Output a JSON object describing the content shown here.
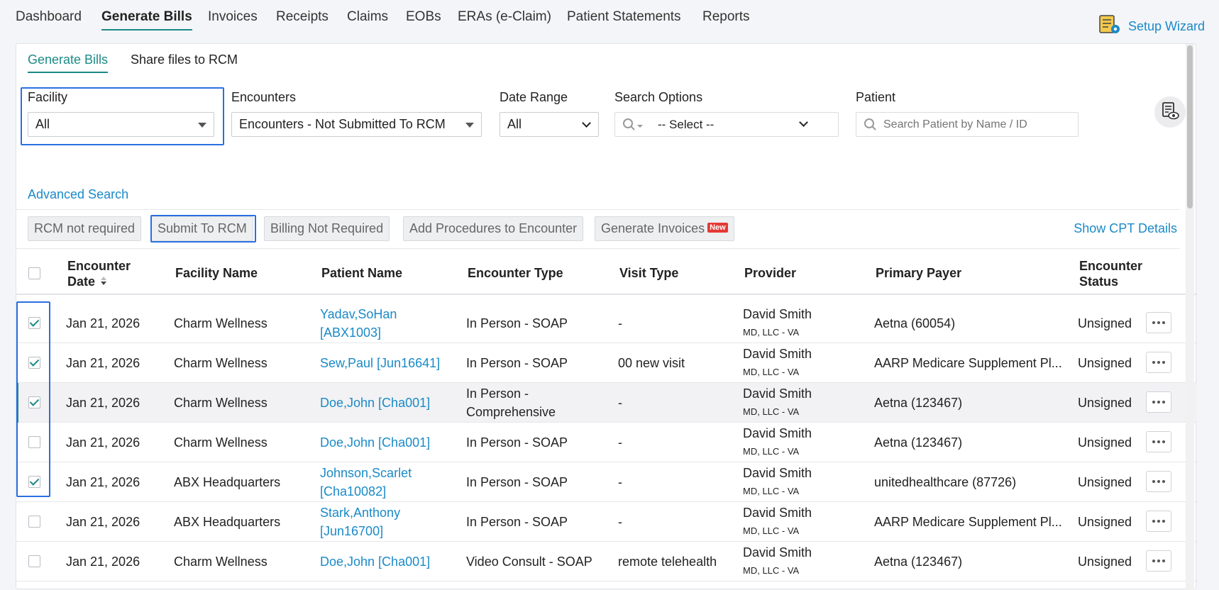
{
  "nav": {
    "items": [
      "Dashboard",
      "Generate Bills",
      "Invoices",
      "Receipts",
      "Claims",
      "EOBs",
      "ERAs (e-Claim)",
      "Patient Statements",
      "Reports"
    ],
    "active": "Generate Bills",
    "setup_wizard": "Setup Wizard"
  },
  "subtabs": {
    "generate_bills": "Generate Bills",
    "share_files": "Share files to RCM"
  },
  "filters": {
    "facility_label": "Facility",
    "facility_value": "All",
    "encounters_label": "Encounters",
    "encounters_value": "Encounters - Not Submitted To RCM",
    "date_range_label": "Date Range",
    "date_range_value": "All",
    "search_options_label": "Search Options",
    "search_options_value": "-- Select --",
    "patient_label": "Patient",
    "patient_placeholder": "Search Patient by Name / ID"
  },
  "advanced_search": "Advanced Search",
  "actions": {
    "rcm_not_required": "RCM not required",
    "submit_to_rcm": "Submit To RCM",
    "billing_not_required": "Billing Not Required",
    "add_procedures": "Add Procedures to Encounter",
    "generate_invoices": "Generate Invoices",
    "new_badge": "New",
    "show_cpt": "Show CPT Details"
  },
  "table": {
    "headers": {
      "encounter_date_1": "Encounter",
      "encounter_date_2": "Date",
      "facility": "Facility Name",
      "patient": "Patient Name",
      "encounter_type": "Encounter Type",
      "visit_type": "Visit Type",
      "provider": "Provider",
      "payer": "Primary Payer",
      "status_1": "Encounter",
      "status_2": "Status"
    },
    "rows": [
      {
        "checked": true,
        "date": "Jan 21, 2026",
        "facility": "Charm Wellness",
        "patient1": "Yadav,SoHan",
        "patient2": "[ABX1003]",
        "type1": "In Person - SOAP",
        "type2": "",
        "visit": "-",
        "provider": "David Smith",
        "provider_sub": "MD, LLC - VA",
        "payer": "Aetna (60054)",
        "status": "Unsigned"
      },
      {
        "checked": true,
        "date": "Jan 21, 2026",
        "facility": "Charm Wellness",
        "patient1": "Sew,Paul [Jun16641]",
        "patient2": "",
        "type1": "In Person - SOAP",
        "type2": "",
        "visit": "00 new visit",
        "provider": "David Smith",
        "provider_sub": "MD, LLC - VA",
        "payer": "AARP Medicare Supplement Pl...",
        "status": "Unsigned"
      },
      {
        "checked": true,
        "date": "Jan 21, 2026",
        "facility": "Charm Wellness",
        "patient1": "Doe,John [Cha001]",
        "patient2": "",
        "type1": "In Person -",
        "type2": "Comprehensive",
        "visit": "-",
        "provider": "David Smith",
        "provider_sub": "MD, LLC - VA",
        "payer": "Aetna (123467)",
        "status": "Unsigned"
      },
      {
        "checked": false,
        "date": "Jan 21, 2026",
        "facility": "Charm Wellness",
        "patient1": "Doe,John [Cha001]",
        "patient2": "",
        "type1": "In Person - SOAP",
        "type2": "",
        "visit": "-",
        "provider": "David Smith",
        "provider_sub": "MD, LLC - VA",
        "payer": "Aetna (123467)",
        "status": "Unsigned"
      },
      {
        "checked": true,
        "date": "Jan 21, 2026",
        "facility": "ABX Headquarters",
        "patient1": "Johnson,Scarlet",
        "patient2": "[Cha10082]",
        "type1": "In Person - SOAP",
        "type2": "",
        "visit": "-",
        "provider": "David Smith",
        "provider_sub": "MD, LLC - VA",
        "payer": "unitedhealthcare (87726)",
        "status": "Unsigned"
      },
      {
        "checked": false,
        "date": "Jan 21, 2026",
        "facility": "ABX Headquarters",
        "patient1": "Stark,Anthony",
        "patient2": "[Jun16700]",
        "type1": "In Person - SOAP",
        "type2": "",
        "visit": "-",
        "provider": "David Smith",
        "provider_sub": "MD, LLC - VA",
        "payer": "AARP Medicare Supplement Pl...",
        "status": "Unsigned"
      },
      {
        "checked": false,
        "date": "Jan 21, 2026",
        "facility": "Charm Wellness",
        "patient1": "Doe,John [Cha001]",
        "patient2": "",
        "type1": "Video Consult - SOAP",
        "type2": "",
        "visit": "remote telehealth",
        "provider": "David Smith",
        "provider_sub": "MD, LLC - VA",
        "payer": "Aetna (123467)",
        "status": "Unsigned"
      }
    ]
  },
  "colors": {
    "accent": "#1b8a86",
    "link": "#1a8ac8",
    "highlight": "#2a6fe0",
    "badge": "#e53935"
  }
}
